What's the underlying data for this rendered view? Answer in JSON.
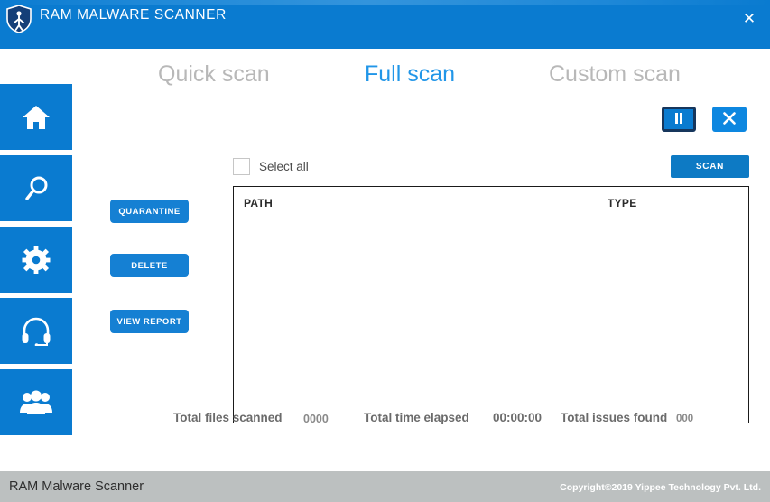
{
  "window": {
    "title": "RAM MALWARE SCANNER",
    "logo_icon": "shield-person-icon",
    "close_icon": "✕",
    "titlebar_color": "#0a7bd0"
  },
  "sidebar": {
    "items": [
      {
        "name": "home",
        "icon": "home-icon"
      },
      {
        "name": "scan",
        "icon": "search-icon"
      },
      {
        "name": "settings",
        "icon": "gear-icon"
      },
      {
        "name": "support",
        "icon": "headset-icon"
      },
      {
        "name": "users",
        "icon": "users-icon"
      }
    ]
  },
  "tabs": [
    {
      "id": "quick",
      "label": "Quick scan",
      "active": false
    },
    {
      "id": "full",
      "label": "Full scan",
      "active": true
    },
    {
      "id": "custom",
      "label": "Custom scan",
      "active": false
    }
  ],
  "controls": {
    "pause_icon": "pause-icon",
    "pause_glyph": "❙❙",
    "stop_icon": "close-icon",
    "stop_glyph": "✕"
  },
  "toolbar": {
    "select_all_label": "Select all",
    "select_all_checked": false,
    "scan_label": "SCAN"
  },
  "actions": {
    "quarantine_label": "QUARANTINE",
    "delete_label": "DELETE",
    "view_report_label": "VIEW REPORT"
  },
  "table": {
    "columns": [
      "PATH",
      "TYPE"
    ],
    "rows": []
  },
  "stats": {
    "files_label": "Total files scanned",
    "files_value": "0000",
    "time_label": "Total time elapsed",
    "time_value": "00:00:00",
    "issues_label": "Total issues found",
    "issues_value": "000"
  },
  "footer": {
    "left": "RAM Malware Scanner",
    "right": "Copyright©2019 Yippee Technology Pvt. Ltd."
  },
  "colors": {
    "accent": "#0a7bd0",
    "tab_active": "#2196e8",
    "tab_inactive": "#b8b8b8",
    "footer_bg": "#bcc0c0"
  }
}
